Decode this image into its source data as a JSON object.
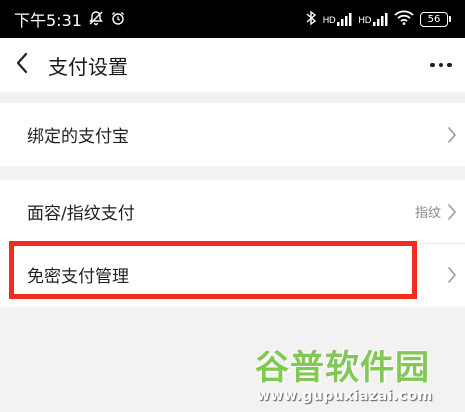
{
  "status_bar": {
    "time": "下午5:31",
    "battery": "56",
    "signal_label_1": "HD",
    "signal_label_2": "HD"
  },
  "header": {
    "title": "支付设置"
  },
  "settings": {
    "group1": [
      {
        "label": "绑定的支付宝"
      }
    ],
    "group2": [
      {
        "label": "面容/指纹支付",
        "value": "指纹"
      },
      {
        "label": "免密支付管理"
      }
    ]
  },
  "watermark": {
    "title": "谷普软件园",
    "url": "www.gupuxiazai.com"
  },
  "colors": {
    "highlight": "#f12d22",
    "watermark_green": "#6ec13a"
  }
}
